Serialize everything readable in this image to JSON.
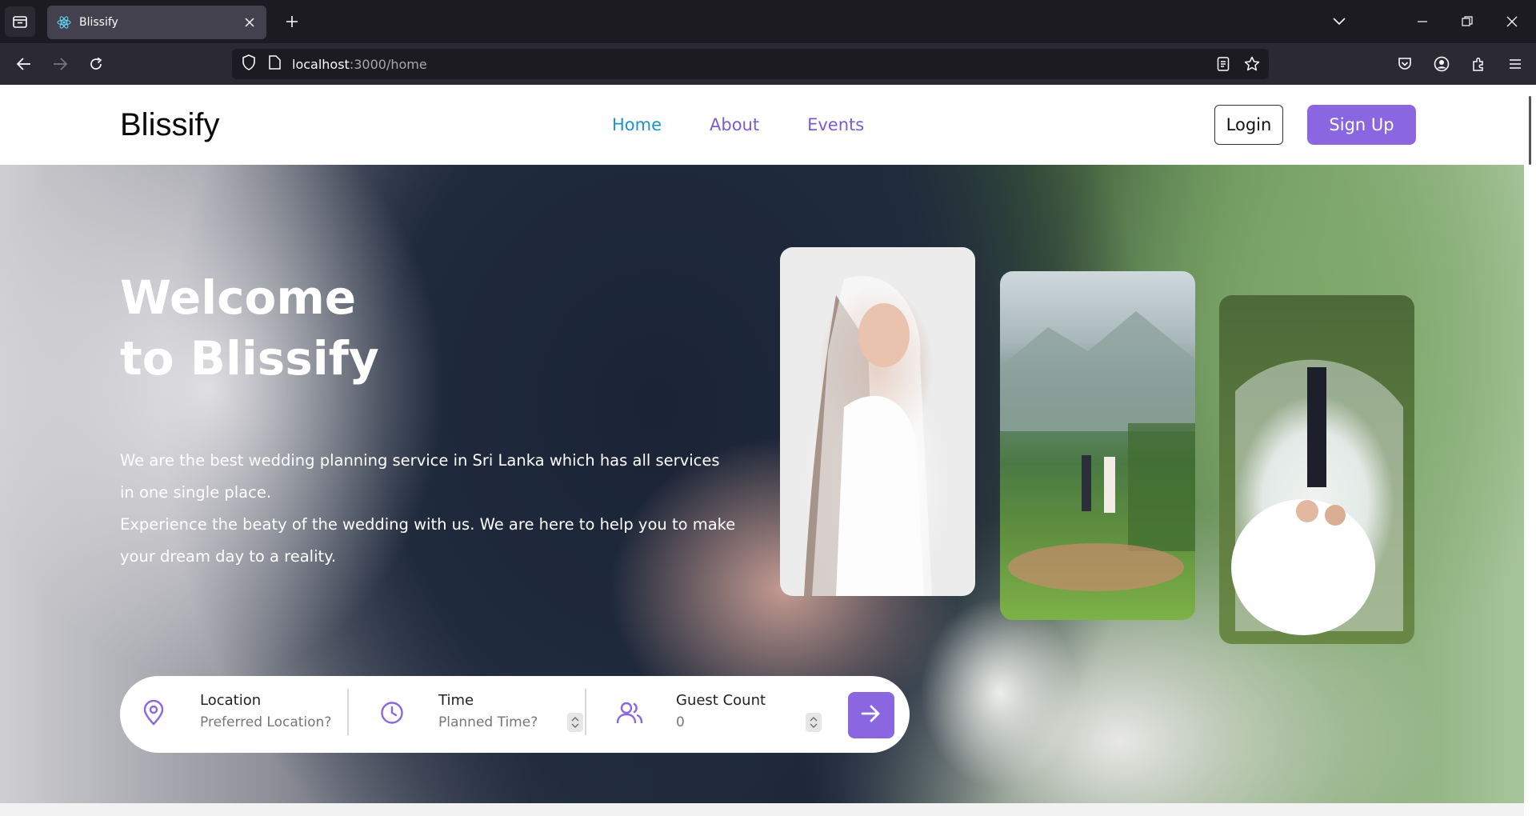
{
  "browser": {
    "tab_title": "Blissify",
    "url_host": "localhost",
    "url_rest": ":3000/home"
  },
  "site": {
    "logo": "Blissify",
    "nav": [
      {
        "label": "Home",
        "active": true
      },
      {
        "label": "About",
        "active": false
      },
      {
        "label": "Events",
        "active": false
      }
    ],
    "login_label": "Login",
    "signup_label": "Sign Up"
  },
  "hero": {
    "title_line1": "Welcome",
    "title_line2": "to Blissify",
    "desc_line1": "We are the best wedding planning service in Sri Lanka which has all services in one single place.",
    "desc_line2": "Experience the beaty of the wedding with us. We are here to help you to make your dream day to a reality."
  },
  "search": {
    "location": {
      "label": "Location",
      "placeholder": "Preferred Location?"
    },
    "time": {
      "label": "Time",
      "placeholder": "Planned Time?"
    },
    "guests": {
      "label": "Guest Count",
      "value": "0"
    }
  },
  "colors": {
    "accent": "#8a67e0",
    "active_nav": "#1e93c8"
  }
}
